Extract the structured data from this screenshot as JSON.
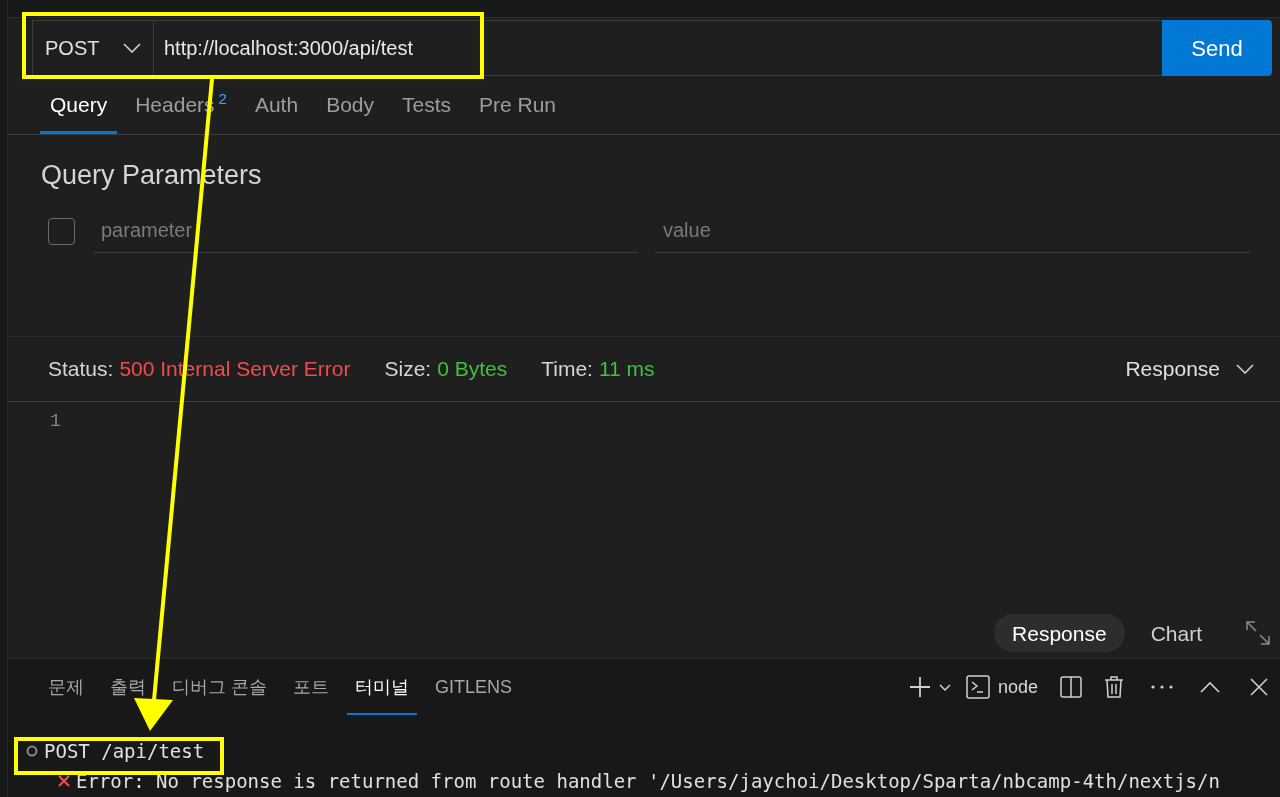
{
  "request": {
    "method": "POST",
    "url": "http://localhost:3000/api/test",
    "send": "Send"
  },
  "tabs": [
    {
      "label": "Query",
      "selected": true
    },
    {
      "label": "Headers",
      "badge": "2",
      "selected": false
    },
    {
      "label": "Auth",
      "selected": false
    },
    {
      "label": "Body",
      "selected": false
    },
    {
      "label": "Tests",
      "selected": false
    },
    {
      "label": "Pre Run",
      "selected": false
    }
  ],
  "query": {
    "title": "Query Parameters",
    "rows": [
      {
        "checked": false,
        "parameter_placeholder": "parameter",
        "value_placeholder": "value"
      }
    ]
  },
  "response": {
    "status_label": "Status:",
    "status": "500 Internal Server Error",
    "size_label": "Size:",
    "size": "0 Bytes",
    "time_label": "Time:",
    "time": "11 ms",
    "view": "Response",
    "line_numbers": [
      "1"
    ],
    "modes": [
      {
        "label": "Response",
        "selected": true
      },
      {
        "label": "Chart",
        "selected": false
      }
    ]
  },
  "panel": {
    "tabs": [
      {
        "label": "문제",
        "selected": false
      },
      {
        "label": "출력",
        "selected": false
      },
      {
        "label": "디버그 콘솔",
        "selected": false
      },
      {
        "label": "포트",
        "selected": false
      },
      {
        "label": "터미널",
        "selected": true
      },
      {
        "label": "GITLENS",
        "selected": false
      }
    ],
    "shell": "node",
    "terminal_lines": [
      {
        "kind": "command",
        "text": "POST /api/test"
      },
      {
        "kind": "error",
        "text": "Error: No response is returned from route handler '/Users/jaychoi/Desktop/Sparta/nbcamp-4th/nextjs/n"
      }
    ]
  }
}
